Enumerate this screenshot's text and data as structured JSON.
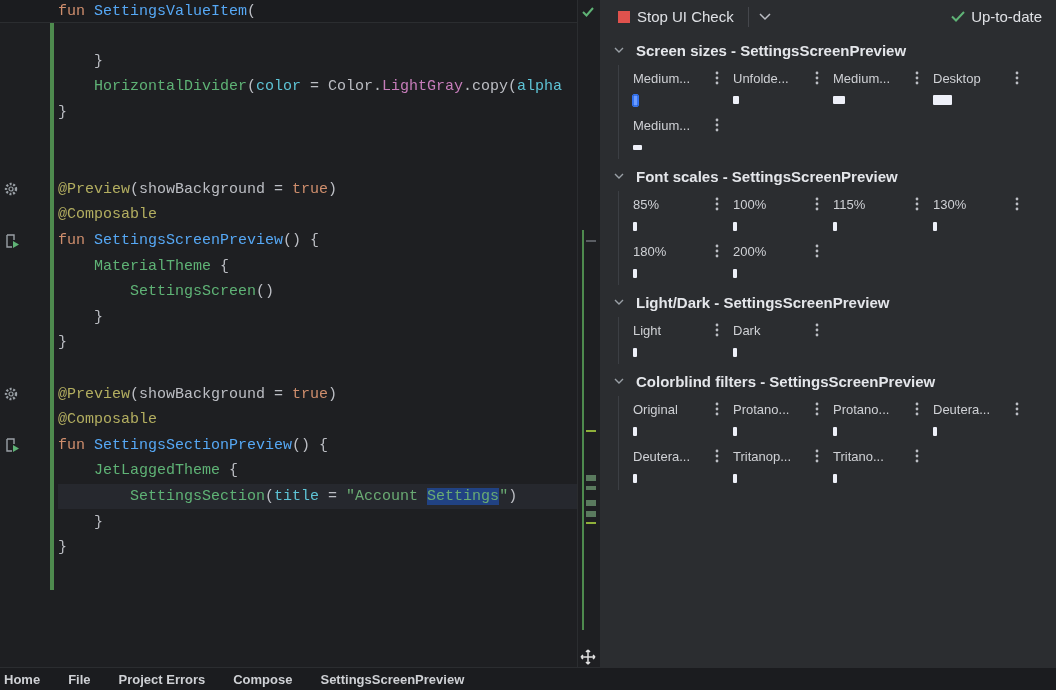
{
  "editor": {
    "sticky_header": {
      "tokens": [
        {
          "text": "fun ",
          "kind": "keyword"
        },
        {
          "text": "SettingsValueItem",
          "kind": "fn"
        },
        {
          "text": "(",
          "kind": "plain"
        }
      ]
    },
    "lines": [
      {
        "kind": "blank"
      },
      {
        "kind": "code",
        "current": false,
        "tokens": [
          {
            "text": "    }",
            "kind": "plain"
          }
        ]
      },
      {
        "kind": "code",
        "current": false,
        "tokens": [
          {
            "text": "    HorizontalDivider",
            "kind": "call"
          },
          {
            "text": "(",
            "kind": "plain"
          },
          {
            "text": "color",
            "kind": "param"
          },
          {
            "text": " = Color.",
            "kind": "plain"
          },
          {
            "text": "LightGray",
            "kind": "property"
          },
          {
            "text": ".copy(",
            "kind": "plain"
          },
          {
            "text": "alpha",
            "kind": "param"
          }
        ]
      },
      {
        "kind": "code",
        "current": false,
        "tokens": [
          {
            "text": "}",
            "kind": "plain"
          }
        ]
      },
      {
        "kind": "blank"
      },
      {
        "kind": "blank"
      },
      {
        "kind": "preview",
        "current": false,
        "tokens": [
          {
            "text": "@Preview",
            "kind": "annotation"
          },
          {
            "text": "(showBackground = ",
            "kind": "plain"
          },
          {
            "text": "true",
            "kind": "keyword"
          },
          {
            "text": ")",
            "kind": "plain"
          }
        ]
      },
      {
        "kind": "code",
        "current": false,
        "tokens": [
          {
            "text": "@Composable",
            "kind": "annotation"
          }
        ]
      },
      {
        "kind": "run",
        "current": false,
        "tokens": [
          {
            "text": "fun ",
            "kind": "keyword"
          },
          {
            "text": "SettingsScreenPreview",
            "kind": "fn"
          },
          {
            "text": "() {",
            "kind": "plain"
          }
        ]
      },
      {
        "kind": "code",
        "current": false,
        "tokens": [
          {
            "text": "    MaterialTheme",
            "kind": "call"
          },
          {
            "text": " {",
            "kind": "plain"
          }
        ]
      },
      {
        "kind": "code",
        "current": false,
        "tokens": [
          {
            "text": "        SettingsScreen",
            "kind": "call"
          },
          {
            "text": "()",
            "kind": "plain"
          }
        ]
      },
      {
        "kind": "code",
        "current": false,
        "tokens": [
          {
            "text": "    }",
            "kind": "plain"
          }
        ]
      },
      {
        "kind": "code",
        "current": false,
        "tokens": [
          {
            "text": "}",
            "kind": "plain"
          }
        ]
      },
      {
        "kind": "blank"
      },
      {
        "kind": "preview",
        "current": false,
        "tokens": [
          {
            "text": "@Preview",
            "kind": "annotation"
          },
          {
            "text": "(showBackground = ",
            "kind": "plain"
          },
          {
            "text": "true",
            "kind": "keyword"
          },
          {
            "text": ")",
            "kind": "plain"
          }
        ]
      },
      {
        "kind": "code",
        "current": false,
        "tokens": [
          {
            "text": "@Composable",
            "kind": "annotation"
          }
        ]
      },
      {
        "kind": "run",
        "current": false,
        "tokens": [
          {
            "text": "fun ",
            "kind": "keyword"
          },
          {
            "text": "SettingsSectionPreview",
            "kind": "fn"
          },
          {
            "text": "() {",
            "kind": "plain"
          }
        ]
      },
      {
        "kind": "code",
        "current": false,
        "tokens": [
          {
            "text": "    JetLaggedTheme",
            "kind": "call"
          },
          {
            "text": " {",
            "kind": "plain"
          }
        ]
      },
      {
        "kind": "code",
        "current": true,
        "tokens": [
          {
            "text": "        SettingsSection",
            "kind": "call"
          },
          {
            "text": "(",
            "kind": "plain"
          },
          {
            "text": "title",
            "kind": "param"
          },
          {
            "text": " = ",
            "kind": "plain"
          },
          {
            "text": "\"Account ",
            "kind": "string"
          },
          {
            "text": "Settings",
            "kind": "selected"
          },
          {
            "text": "\"",
            "kind": "string"
          },
          {
            "text": ")",
            "kind": "plain"
          }
        ]
      },
      {
        "kind": "code",
        "current": false,
        "tokens": [
          {
            "text": "    }",
            "kind": "plain"
          }
        ]
      },
      {
        "kind": "code",
        "current": false,
        "tokens": [
          {
            "text": "}",
            "kind": "plain"
          }
        ]
      }
    ]
  },
  "preview_panel": {
    "toolbar": {
      "stop_label": "Stop UI Check",
      "status": "Up-to-date"
    },
    "groups": [
      {
        "title": "Screen sizes - SettingsScreenPreview",
        "expanded": true,
        "previews": [
          {
            "label": "Medium...",
            "kind": "tall",
            "selected": true
          },
          {
            "label": "Unfolde...",
            "kind": "small",
            "selected": false
          },
          {
            "label": "Medium...",
            "kind": "landscape",
            "selected": false
          },
          {
            "label": "Desktop",
            "kind": "wide",
            "selected": false
          },
          {
            "label": "Medium...",
            "kind": "flat",
            "selected": false
          }
        ]
      },
      {
        "title": "Font scales - SettingsScreenPreview",
        "expanded": true,
        "previews": [
          {
            "label": "85%",
            "kind": "narrow",
            "selected": false
          },
          {
            "label": "100%",
            "kind": "narrow",
            "selected": false
          },
          {
            "label": "115%",
            "kind": "narrow",
            "selected": false
          },
          {
            "label": "130%",
            "kind": "narrow",
            "selected": false
          },
          {
            "label": "180%",
            "kind": "narrow",
            "selected": false
          },
          {
            "label": "200%",
            "kind": "narrow",
            "selected": false
          }
        ]
      },
      {
        "title": "Light/Dark - SettingsScreenPreview",
        "expanded": true,
        "previews": [
          {
            "label": "Light",
            "kind": "narrow",
            "selected": false
          },
          {
            "label": "Dark",
            "kind": "narrow",
            "selected": false
          }
        ]
      },
      {
        "title": "Colorblind filters - SettingsScreenPreview",
        "expanded": true,
        "previews": [
          {
            "label": "Original",
            "kind": "narrow",
            "selected": false
          },
          {
            "label": "Protano...",
            "kind": "narrow",
            "selected": false
          },
          {
            "label": "Protano...",
            "kind": "narrow",
            "selected": false
          },
          {
            "label": "Deutera...",
            "kind": "narrow",
            "selected": false
          },
          {
            "label": "Deutera...",
            "kind": "narrow",
            "selected": false
          },
          {
            "label": "Tritanop...",
            "kind": "narrow",
            "selected": false
          },
          {
            "label": "Tritano...",
            "kind": "narrow",
            "selected": false
          }
        ]
      }
    ]
  },
  "bottom_tabs": [
    "Home",
    "File",
    "Project Errors",
    "Compose",
    "SettingsScreenPreview"
  ]
}
